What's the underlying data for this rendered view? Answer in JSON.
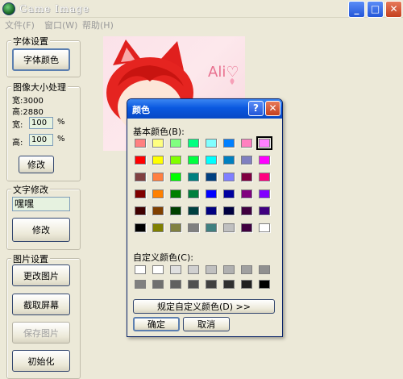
{
  "window": {
    "title": "Game Image",
    "controls": {
      "minimize": "_",
      "maximize": "□",
      "close": "✕"
    }
  },
  "menu": [
    {
      "label": "文件(F)"
    },
    {
      "label": "窗口(W)"
    },
    {
      "label": "帮助(H)"
    }
  ],
  "font_group": {
    "title": "字体设置",
    "button": "字体颜色"
  },
  "resize_group": {
    "title": "图像大小处理",
    "width_text": "宽:3000",
    "height_text": "高:2880",
    "width_label": "宽:",
    "height_label": "高:",
    "width_value": "100",
    "height_value": "100",
    "unit": "%",
    "modify_button": "修改"
  },
  "text_group": {
    "title": "文字修改",
    "value": "嘿嘿",
    "modify_button": "修改"
  },
  "image_group": {
    "title": "图片设置",
    "change_button": "更改图片",
    "capture_button": "截取屏幕",
    "save_button": "保存图片",
    "init_button": "初始化"
  },
  "picture": {
    "caption": "Ali♡"
  },
  "color_dialog": {
    "title": "颜色",
    "basic_label": "基本颜色(B):",
    "custom_label": "自定义颜色(C):",
    "define_custom_button": "规定自定义颜色(D) >>",
    "ok_button": "确定",
    "cancel_button": "取消",
    "help_icon": "?",
    "close_icon": "✕",
    "basic_colors": [
      [
        "#ff8080",
        "#ffff80",
        "#80ff80",
        "#00ff80",
        "#80ffff",
        "#0080ff",
        "#ff80c0",
        "#ff80ff"
      ],
      [
        "#ff0000",
        "#ffff00",
        "#80ff00",
        "#00ff40",
        "#00ffff",
        "#0080c0",
        "#8080c0",
        "#ff00ff"
      ],
      [
        "#804040",
        "#ff8040",
        "#00ff00",
        "#008080",
        "#004080",
        "#8080ff",
        "#800040",
        "#ff0080"
      ],
      [
        "#800000",
        "#ff8000",
        "#008000",
        "#008040",
        "#0000ff",
        "#0000a0",
        "#800080",
        "#8000ff"
      ],
      [
        "#400000",
        "#804000",
        "#004000",
        "#004040",
        "#000080",
        "#000040",
        "#400040",
        "#400080"
      ],
      [
        "#000000",
        "#808000",
        "#808040",
        "#808080",
        "#408080",
        "#c0c0c0",
        "#400040",
        "#ffffff"
      ]
    ],
    "selected_color": "#ff80ff",
    "custom_colors": [
      [
        "#ffffff",
        "#ffffff",
        "#e0e0e0",
        "#d0d0d0",
        "#c0c0c0",
        "#b0b0b0",
        "#a0a0a0",
        "#909090"
      ],
      [
        "#808080",
        "#707070",
        "#606060",
        "#505050",
        "#404040",
        "#303030",
        "#202020",
        "#000000"
      ]
    ]
  }
}
